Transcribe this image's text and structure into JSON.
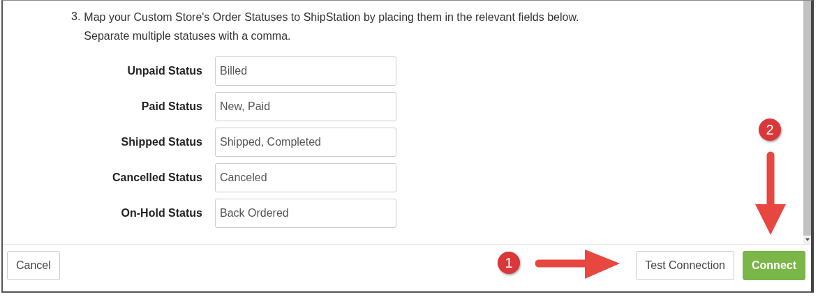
{
  "instructions": {
    "number": "3.",
    "lines": [
      "Map your Custom Store's Order Statuses to ShipStation by placing them in the relevant fields below.",
      "Separate multiple statuses with a comma."
    ]
  },
  "fields": [
    {
      "label": "Unpaid Status",
      "value": "Billed"
    },
    {
      "label": "Paid Status",
      "value": "New, Paid"
    },
    {
      "label": "Shipped Status",
      "value": "Shipped, Completed"
    },
    {
      "label": "Cancelled Status",
      "value": "Canceled"
    },
    {
      "label": "On-Hold Status",
      "value": "Back Ordered"
    }
  ],
  "footer": {
    "cancel": "Cancel",
    "test": "Test Connection",
    "connect": "Connect"
  },
  "annotations": [
    {
      "number": "1",
      "kind": "right"
    },
    {
      "number": "2",
      "kind": "down"
    }
  ]
}
